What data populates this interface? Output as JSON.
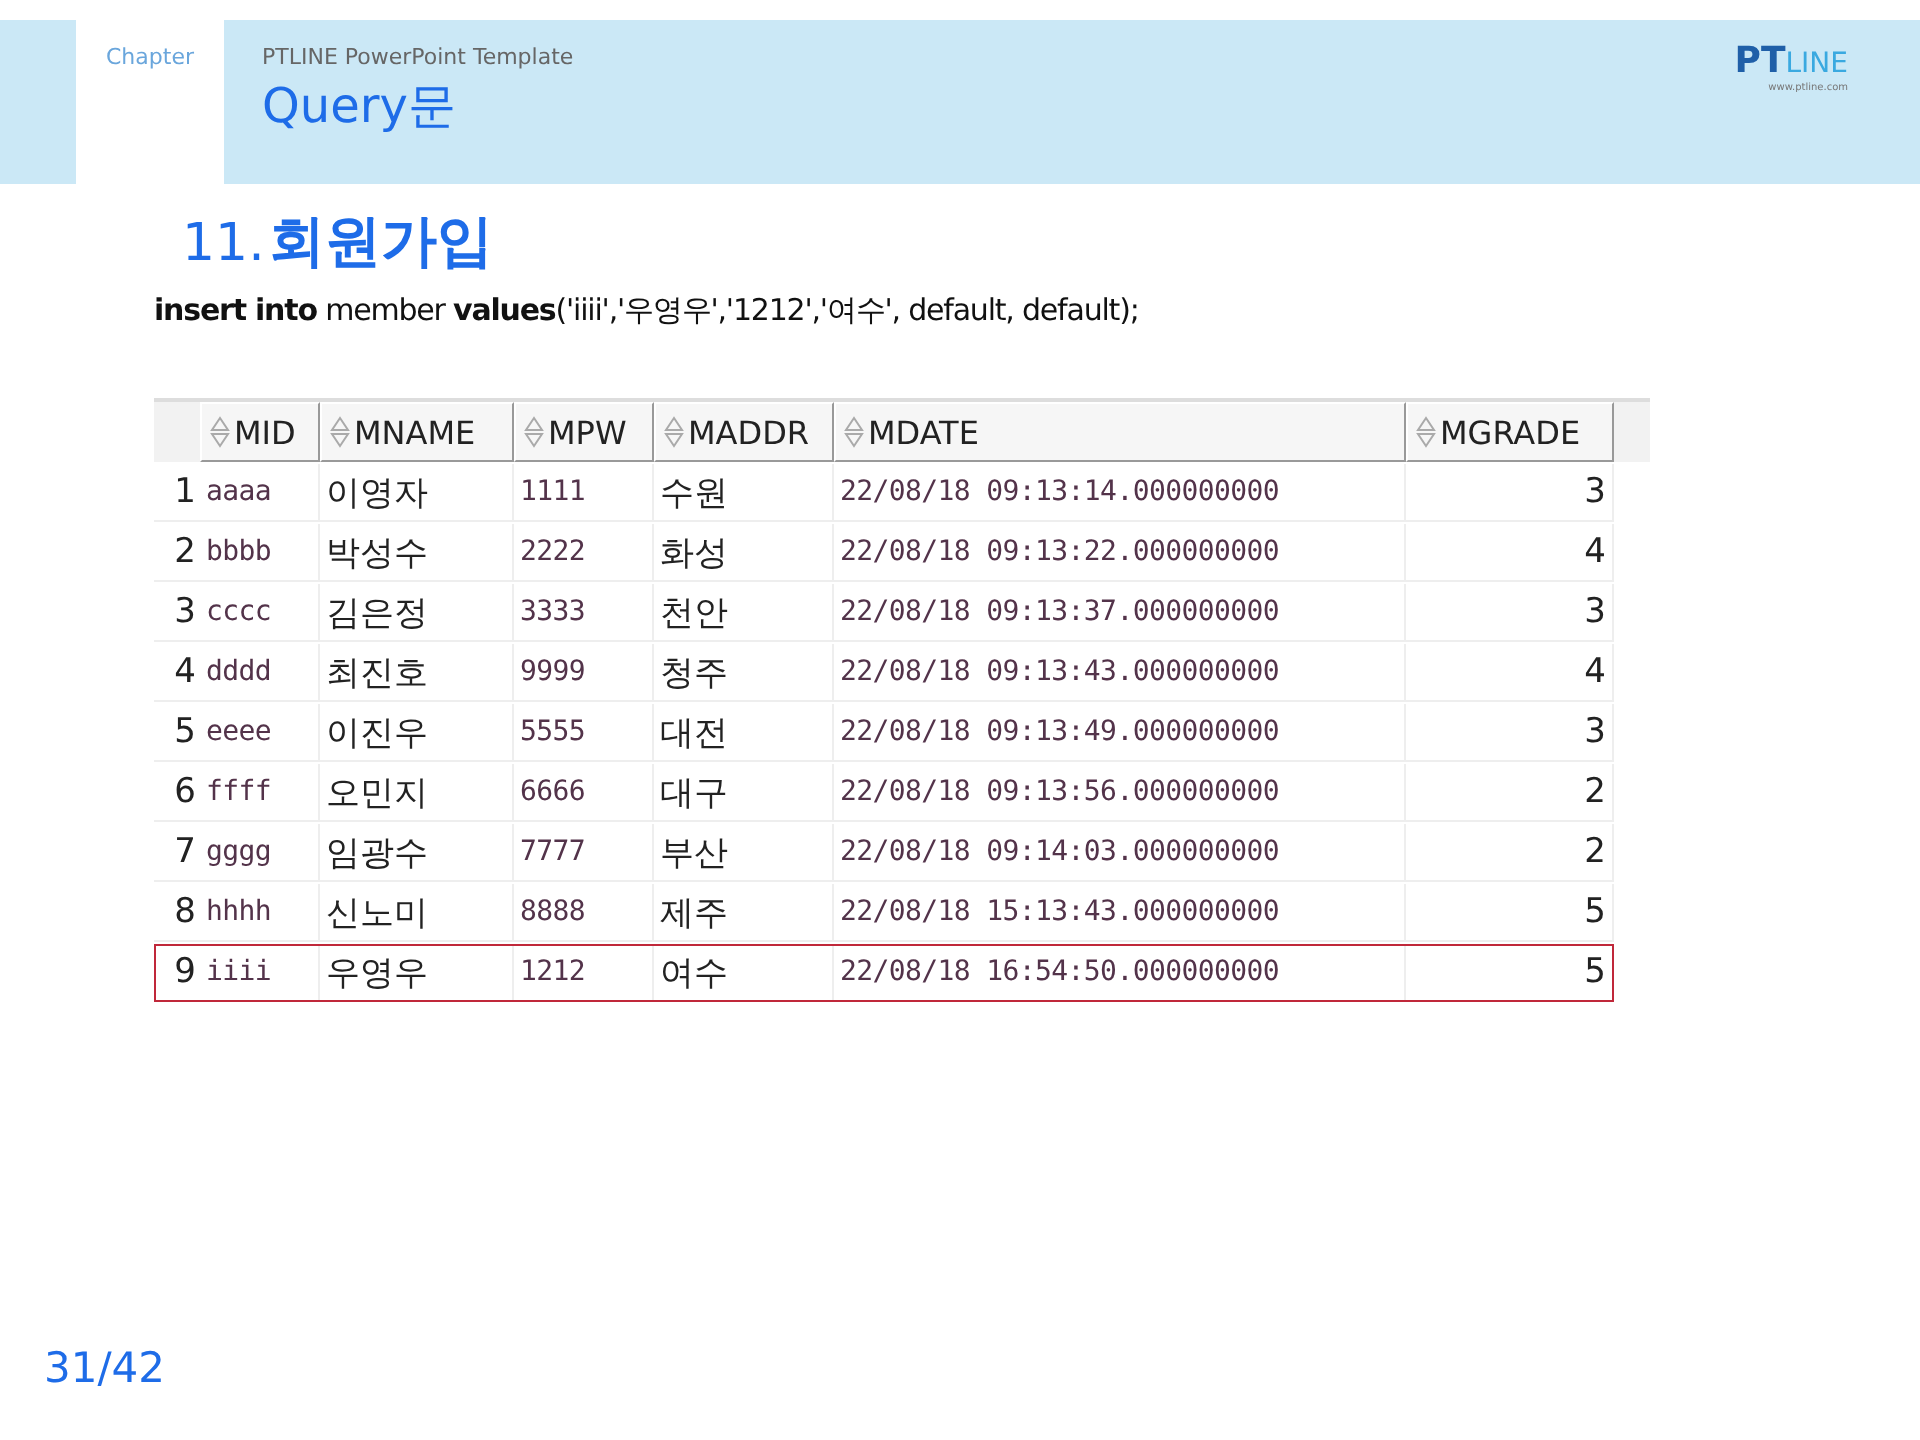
{
  "header": {
    "chapter": "Chapter",
    "template": "PTLINE PowerPoint Template",
    "title": "Query문",
    "logo": {
      "bold": "PT",
      "light": "LINE",
      "url": "www.ptline.com"
    }
  },
  "section": {
    "number": "11.",
    "title": "회원가입"
  },
  "sql": "**insert into** member **values**('iiii','우영우','1212','여수',  default, default);",
  "table": {
    "columns": [
      "MID",
      "MNAME",
      "MPW",
      "MADDR",
      "MDATE",
      "MGRADE"
    ],
    "rows": [
      {
        "num": "1",
        "cells": [
          "aaaa",
          "이영자",
          "1111",
          "수원",
          "22/08/18 09:13:14.000000000",
          "3"
        ],
        "highlighted": false
      },
      {
        "num": "2",
        "cells": [
          "bbbb",
          "박성수",
          "2222",
          "화성",
          "22/08/18 09:13:22.000000000",
          "4"
        ],
        "highlighted": false
      },
      {
        "num": "3",
        "cells": [
          "cccc",
          "김은정",
          "3333",
          "천안",
          "22/08/18 09:13:37.000000000",
          "3"
        ],
        "highlighted": false
      },
      {
        "num": "4",
        "cells": [
          "dddd",
          "최진호",
          "9999",
          "청주",
          "22/08/18 09:13:43.000000000",
          "4"
        ],
        "highlighted": false
      },
      {
        "num": "5",
        "cells": [
          "eeee",
          "이진우",
          "5555",
          "대전",
          "22/08/18 09:13:49.000000000",
          "3"
        ],
        "highlighted": false
      },
      {
        "num": "6",
        "cells": [
          "ffff",
          "오민지",
          "6666",
          "대구",
          "22/08/18 09:13:56.000000000",
          "2"
        ],
        "highlighted": false
      },
      {
        "num": "7",
        "cells": [
          "gggg",
          "임광수",
          "7777",
          "부산",
          "22/08/18 09:14:03.000000000",
          "2"
        ],
        "highlighted": false
      },
      {
        "num": "8",
        "cells": [
          "hhhh",
          "신노미",
          "8888",
          "제주",
          "22/08/18 15:13:43.000000000",
          "5"
        ],
        "highlighted": false
      },
      {
        "num": "9",
        "cells": [
          "iiii",
          "우영우",
          "1212",
          "여수",
          "22/08/18 16:54:50.000000000",
          "5"
        ],
        "highlighted": true
      }
    ]
  },
  "page": "31/42"
}
